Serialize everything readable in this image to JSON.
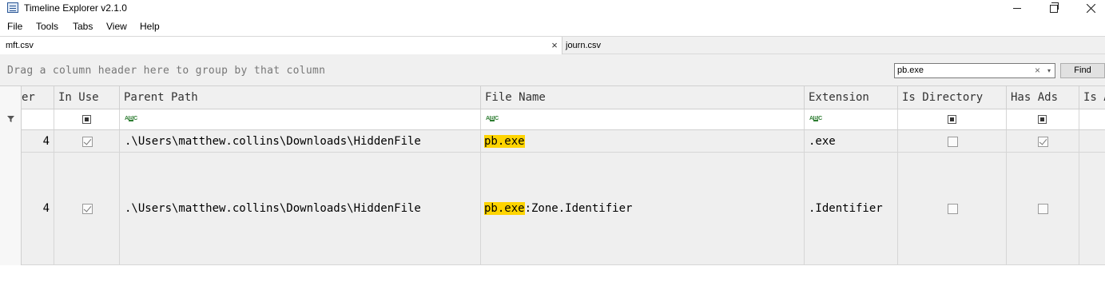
{
  "window": {
    "title": "Timeline Explorer v2.1.0"
  },
  "menu": {
    "items": [
      "File",
      "Tools",
      "Tabs",
      "View",
      "Help"
    ]
  },
  "tabs": [
    {
      "label": "mft.csv",
      "active": true,
      "close": "×"
    },
    {
      "label": "journ.csv",
      "active": false
    }
  ],
  "group_panel": {
    "hint": "Drag a column header here to group by that column"
  },
  "search": {
    "value": "pb.exe",
    "clear": "×",
    "dropdown": "▾",
    "find_label": "Find"
  },
  "grid": {
    "columns": [
      "er",
      "In Use",
      "Parent Path",
      "File Name",
      "Extension",
      "Is Directory",
      "Has Ads",
      "Is A"
    ],
    "filter_text_icon": [
      "A",
      "B",
      "C"
    ],
    "rows": [
      {
        "sequence": "4",
        "in_use": true,
        "parent_path": ".\\Users\\matthew.collins\\Downloads\\HiddenFile",
        "file_name_match": "pb.exe",
        "file_name_rest": "",
        "extension": ".exe",
        "is_directory": false,
        "has_ads": true
      },
      {
        "sequence": "4",
        "in_use": true,
        "parent_path": ".\\Users\\matthew.collins\\Downloads\\HiddenFile",
        "file_name_match": "pb.exe",
        "file_name_rest": ":Zone.Identifier",
        "extension": ".Identifier",
        "is_directory": false,
        "has_ads": false
      }
    ]
  },
  "colors": {
    "highlight": "#ffd400",
    "row_background": "#efefef",
    "header_background": "#f0f0f0"
  }
}
